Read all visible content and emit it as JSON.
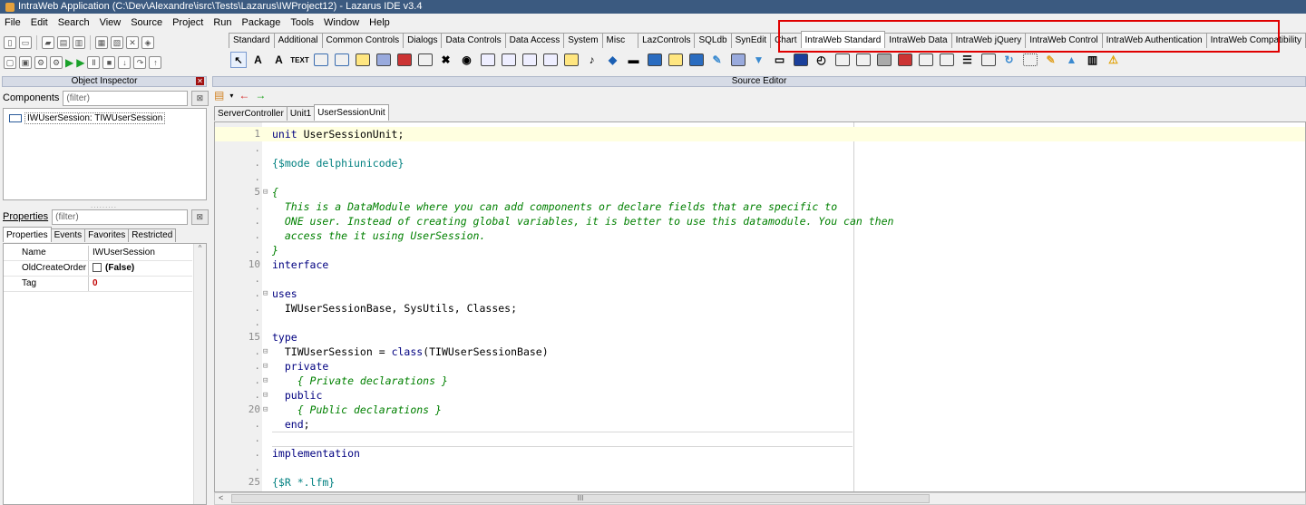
{
  "window": {
    "title": "IntraWeb Application (C:\\Dev\\Alexandre\\isrc\\Tests\\Lazarus\\IWProject12) - Lazarus IDE v3.4"
  },
  "menu": [
    "File",
    "Edit",
    "Search",
    "View",
    "Source",
    "Project",
    "Run",
    "Package",
    "Tools",
    "Window",
    "Help"
  ],
  "component_tabs": [
    "Standard",
    "Additional",
    "Common Controls",
    "Dialogs",
    "Data Controls",
    "Data Access",
    "System",
    "Misc",
    "LazControls",
    "SQLdb",
    "SynEdit",
    "Chart",
    "IntraWeb Standard",
    "IntraWeb Data",
    "IntraWeb jQuery",
    "IntraWeb Control",
    "IntraWeb Authentication",
    "IntraWeb Compatibility"
  ],
  "object_inspector": {
    "title": "Object Inspector",
    "components_label": "Components",
    "components_filter": "(filter)",
    "tree_item": "IWUserSession: TIWUserSession",
    "properties_label": "Properties",
    "properties_filter": "(filter)",
    "tabs": [
      "Properties",
      "Events",
      "Favorites",
      "Restricted"
    ],
    "rows": [
      {
        "name": "Name",
        "value": "IWUserSession"
      },
      {
        "name": "OldCreateOrder",
        "value": "(False)"
      },
      {
        "name": "Tag",
        "value": "0"
      }
    ]
  },
  "source_editor": {
    "title": "Source Editor",
    "tabs": [
      "ServerController",
      "Unit1",
      "UserSessionUnit"
    ],
    "active_tab": "UserSessionUnit",
    "gutter": [
      "1",
      ".",
      ".",
      ".",
      "5",
      ".",
      ".",
      ".",
      ".",
      "10",
      ".",
      ".",
      ".",
      ".",
      "15",
      ".",
      ".",
      ".",
      ".",
      "20",
      ".",
      ".",
      ".",
      ".",
      "25"
    ]
  },
  "colors": {
    "accent": "#e00000",
    "titlebar": "#3b5a80"
  }
}
